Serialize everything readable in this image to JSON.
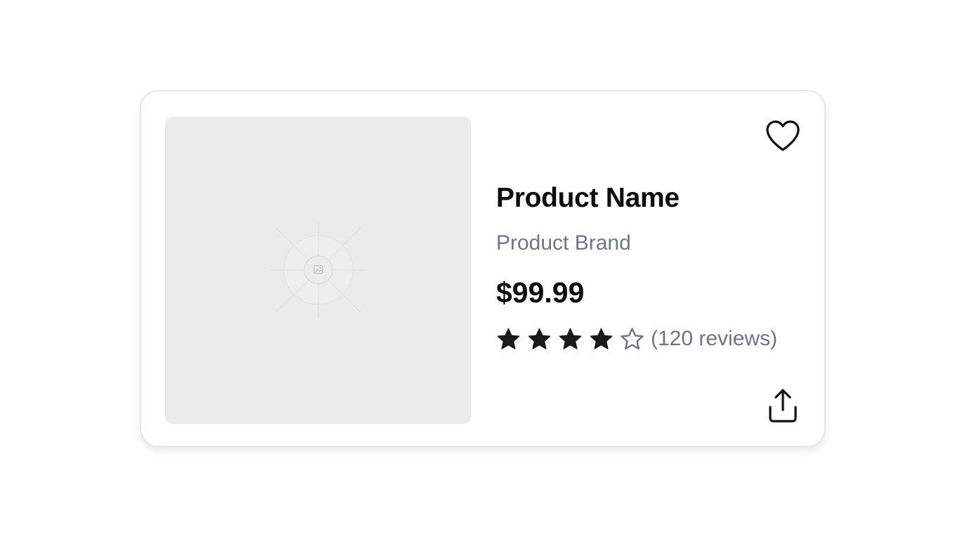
{
  "product": {
    "name": "Product Name",
    "brand": "Product Brand",
    "price": "$99.99",
    "rating": 4,
    "rating_max": 5,
    "reviews_text": "(120 reviews)"
  },
  "icons": {
    "favorite": "heart-icon",
    "share": "share-icon",
    "image": "image-placeholder-icon",
    "star_filled": "star-filled-icon",
    "star_empty": "star-outline-icon"
  },
  "colors": {
    "text_primary": "#0d0d0d",
    "text_secondary": "#6e7584",
    "star_filled": "#1a1a1a",
    "star_empty": "#6e7584",
    "image_bg": "#ebebeb",
    "card_border": "#e6e6e6"
  }
}
